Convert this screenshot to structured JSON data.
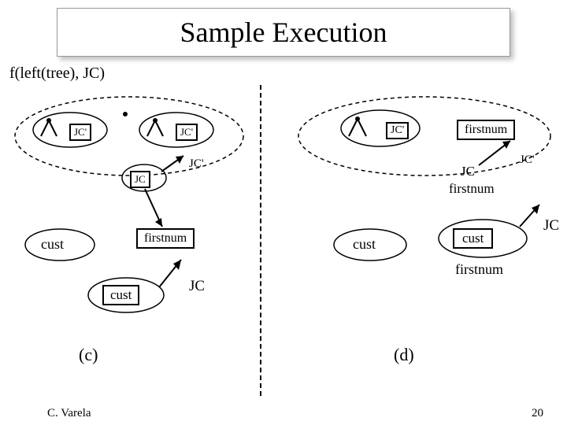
{
  "title": "Sample Execution",
  "expression": "f(left(tree), JC)",
  "labels": {
    "jc_prime": "JC'",
    "jc": "JC",
    "firstnum": "firstnum",
    "cust": "cust"
  },
  "subfigs": {
    "c": "(c)",
    "d": "(d)"
  },
  "footer": {
    "author": "C. Varela",
    "page": "20"
  }
}
